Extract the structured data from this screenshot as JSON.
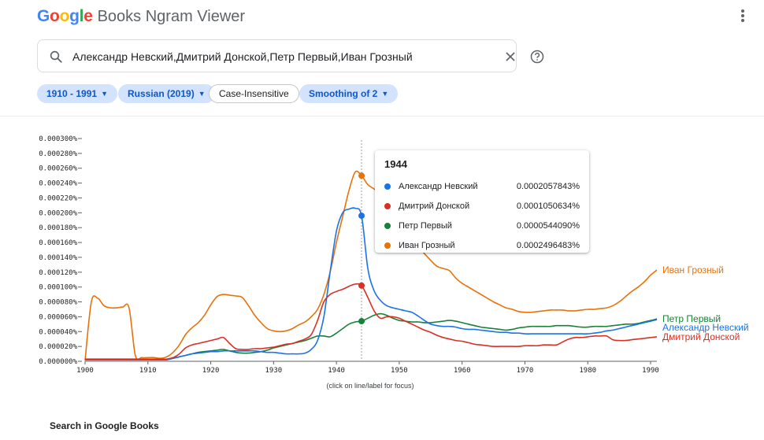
{
  "header": {
    "logo_text": "Google",
    "logo_letters": [
      {
        "ch": "G",
        "color": "#4285F4"
      },
      {
        "ch": "o",
        "color": "#EA4335"
      },
      {
        "ch": "o",
        "color": "#FBBC05"
      },
      {
        "ch": "g",
        "color": "#4285F4"
      },
      {
        "ch": "l",
        "color": "#34A853"
      },
      {
        "ch": "e",
        "color": "#EA4335"
      }
    ],
    "product_name": "Books Ngram Viewer"
  },
  "search": {
    "query": "Александр Невский,Дмитрий Донской,Петр Первый,Иван Грозный"
  },
  "filters": {
    "year_range": "1910 - 1991",
    "corpus": "Russian (2019)",
    "case": "Case-Insensitive",
    "smoothing": "Smoothing of 2"
  },
  "tooltip": {
    "year": "1944",
    "rows": [
      {
        "name": "Александр Невский",
        "value": "0.0002057843%",
        "color": "#1a73e8"
      },
      {
        "name": "Дмитрий Донской",
        "value": "0.0001050634%",
        "color": "#d93025"
      },
      {
        "name": "Петр Первый",
        "value": "0.0000544090%",
        "color": "#188038"
      },
      {
        "name": "Иван Грозный",
        "value": "0.0002496483%",
        "color": "#e8710a"
      }
    ]
  },
  "click_hint": "(click on line/label for focus)",
  "footer": {
    "books_link": "Search in Google Books"
  },
  "chart_data": {
    "type": "line",
    "title": "",
    "xlabel": "",
    "ylabel": "",
    "xlim": [
      1900,
      1991
    ],
    "ylim": [
      0,
      0.0003
    ],
    "x_ticks": [
      1900,
      1910,
      1920,
      1930,
      1940,
      1950,
      1960,
      1970,
      1980,
      1990
    ],
    "y_ticks": [
      {
        "v": 0,
        "label": "0.000000%"
      },
      {
        "v": 2e-05,
        "label": "0.000020%"
      },
      {
        "v": 4e-05,
        "label": "0.000040%"
      },
      {
        "v": 6e-05,
        "label": "0.000060%"
      },
      {
        "v": 8e-05,
        "label": "0.000080%"
      },
      {
        "v": 0.0001,
        "label": "0.000100%"
      },
      {
        "v": 0.00012,
        "label": "0.000120%"
      },
      {
        "v": 0.00014,
        "label": "0.000140%"
      },
      {
        "v": 0.00016,
        "label": "0.000160%"
      },
      {
        "v": 0.00018,
        "label": "0.000180%"
      },
      {
        "v": 0.0002,
        "label": "0.000200%"
      },
      {
        "v": 0.00022,
        "label": "0.000220%"
      },
      {
        "v": 0.00024,
        "label": "0.000240%"
      },
      {
        "v": 0.00026,
        "label": "0.000260%"
      },
      {
        "v": 0.00028,
        "label": "0.000280%"
      },
      {
        "v": 0.0003,
        "label": "0.000300%"
      }
    ],
    "highlight_year": 1944,
    "grid": false,
    "legend": "right-end labels",
    "x": [
      1900,
      1901,
      1902,
      1903,
      1904,
      1905,
      1906,
      1907,
      1908,
      1909,
      1910,
      1911,
      1912,
      1913,
      1914,
      1915,
      1916,
      1917,
      1918,
      1919,
      1920,
      1921,
      1922,
      1923,
      1924,
      1925,
      1926,
      1927,
      1928,
      1929,
      1930,
      1931,
      1932,
      1933,
      1934,
      1935,
      1936,
      1937,
      1938,
      1939,
      1940,
      1941,
      1942,
      1943,
      1944,
      1945,
      1946,
      1947,
      1948,
      1949,
      1950,
      1951,
      1952,
      1953,
      1954,
      1955,
      1956,
      1957,
      1958,
      1959,
      1960,
      1961,
      1962,
      1963,
      1964,
      1965,
      1966,
      1967,
      1968,
      1969,
      1970,
      1971,
      1972,
      1973,
      1974,
      1975,
      1976,
      1977,
      1978,
      1979,
      1980,
      1981,
      1982,
      1983,
      1984,
      1985,
      1986,
      1987,
      1988,
      1989,
      1990,
      1991
    ],
    "series": [
      {
        "name": "Иван Грозный",
        "color": "#e8710a",
        "values": [
          1e-06,
          8e-05,
          8.5e-05,
          7.5e-05,
          7.2e-05,
          7.2e-05,
          7.3e-05,
          7.2e-05,
          8e-06,
          5e-06,
          5e-06,
          5e-06,
          4e-06,
          6e-06,
          1.2e-05,
          2.2e-05,
          3.6e-05,
          4.5e-05,
          5.2e-05,
          6.2e-05,
          7.6e-05,
          8.7e-05,
          9e-05,
          8.9e-05,
          8.8e-05,
          8.6e-05,
          7.5e-05,
          6.2e-05,
          5.2e-05,
          4.4e-05,
          4.1e-05,
          4e-05,
          4.1e-05,
          4.4e-05,
          4.9e-05,
          5.3e-05,
          6e-05,
          7e-05,
          9e-05,
          0.00012,
          0.00016,
          0.000195,
          0.00023,
          0.000255,
          0.00025,
          0.000238,
          0.000232,
          0.000225,
          0.00021,
          0.000196,
          0.00018,
          0.00017,
          0.000165,
          0.000155,
          0.000145,
          0.000136,
          0.000128,
          0.000125,
          0.000122,
          0.000112,
          0.000105,
          0.0001,
          9.5e-05,
          9e-05,
          8.5e-05,
          8e-05,
          7.6e-05,
          7.2e-05,
          7e-05,
          6.7e-05,
          6.6e-05,
          6.6e-05,
          6.7e-05,
          6.8e-05,
          6.9e-05,
          6.9e-05,
          6.9e-05,
          6.8e-05,
          6.8e-05,
          6.9e-05,
          7e-05,
          7e-05,
          7.1e-05,
          7.2e-05,
          7.5e-05,
          8e-05,
          8.7e-05,
          9.4e-05,
          0.0001,
          0.000107,
          0.000116,
          0.000123
        ]
      },
      {
        "name": "Петр Первый",
        "color": "#188038",
        "values": [
          2e-06,
          2e-06,
          2e-06,
          2e-06,
          2e-06,
          2e-06,
          2e-06,
          2e-06,
          2e-06,
          2e-06,
          2e-06,
          2e-06,
          2e-06,
          2e-06,
          4e-06,
          6e-06,
          8e-06,
          1e-05,
          1.2e-05,
          1.3e-05,
          1.4e-05,
          1.5e-05,
          1.6e-05,
          1.4e-05,
          1.2e-05,
          1.1e-05,
          1.1e-05,
          1.2e-05,
          1.3e-05,
          1.5e-05,
          1.8e-05,
          2e-05,
          2.2e-05,
          2.4e-05,
          2.6e-05,
          2.8e-05,
          3.1e-05,
          3.4e-05,
          3.4e-05,
          3.3e-05,
          3.8e-05,
          4.4e-05,
          5e-05,
          5.3e-05,
          5.4e-05,
          5.8e-05,
          6.2e-05,
          6.4e-05,
          6.2e-05,
          5.8e-05,
          5.5e-05,
          5.4e-05,
          5.3e-05,
          5.3e-05,
          5.2e-05,
          5.2e-05,
          5.3e-05,
          5.4e-05,
          5.5e-05,
          5.4e-05,
          5.2e-05,
          5e-05,
          4.8e-05,
          4.6e-05,
          4.5e-05,
          4.4e-05,
          4.3e-05,
          4.2e-05,
          4.3e-05,
          4.5e-05,
          4.6e-05,
          4.7e-05,
          4.7e-05,
          4.7e-05,
          4.7e-05,
          4.8e-05,
          4.8e-05,
          4.8e-05,
          4.7e-05,
          4.6e-05,
          4.6e-05,
          4.7e-05,
          4.7e-05,
          4.7e-05,
          4.8e-05,
          4.9e-05,
          5e-05,
          5e-05,
          5.1e-05,
          5.3e-05,
          5.5e-05,
          5.7e-05
        ]
      },
      {
        "name": "Александр Невский",
        "color": "#1a73e8",
        "values": [
          2e-06,
          2e-06,
          2e-06,
          2e-06,
          2e-06,
          2e-06,
          2e-06,
          2e-06,
          2e-06,
          2e-06,
          2e-06,
          2e-06,
          2e-06,
          2e-06,
          4e-06,
          6e-06,
          8e-06,
          1e-05,
          1.1e-05,
          1.2e-05,
          1.3e-05,
          1.3e-05,
          1.4e-05,
          1.4e-05,
          1.4e-05,
          1.4e-05,
          1.4e-05,
          1.4e-05,
          1.3e-05,
          1.2e-05,
          1.2e-05,
          1.1e-05,
          1e-05,
          1e-05,
          1e-05,
          1.1e-05,
          1.6e-05,
          2.8e-05,
          6e-05,
          0.00012,
          0.000175,
          0.0002,
          0.000205,
          0.000206,
          0.000196,
          0.000125,
          9.5e-05,
          8.2e-05,
          7.5e-05,
          7.2e-05,
          7e-05,
          6.8e-05,
          6.6e-05,
          6.1e-05,
          5.5e-05,
          5e-05,
          4.8e-05,
          4.7e-05,
          4.7e-05,
          4.6e-05,
          4.4e-05,
          4.3e-05,
          4.3e-05,
          4.2e-05,
          4.1e-05,
          4e-05,
          3.9e-05,
          3.9e-05,
          3.8e-05,
          3.8e-05,
          3.7e-05,
          3.7e-05,
          3.7e-05,
          3.7e-05,
          3.7e-05,
          3.7e-05,
          3.7e-05,
          3.7e-05,
          3.7e-05,
          3.7e-05,
          3.7e-05,
          3.8e-05,
          3.9e-05,
          4.1e-05,
          4.2e-05,
          4.4e-05,
          4.6e-05,
          4.8e-05,
          5e-05,
          5.2e-05,
          5.4e-05,
          5.6e-05
        ]
      },
      {
        "name": "Дмитрий Донской",
        "color": "#d93025",
        "values": [
          3e-06,
          3e-06,
          3e-06,
          3e-06,
          3e-06,
          3e-06,
          3e-06,
          3e-06,
          3e-06,
          3e-06,
          3e-06,
          3e-06,
          3e-06,
          3e-06,
          5e-06,
          1e-05,
          1.8e-05,
          2.2e-05,
          2.4e-05,
          2.6e-05,
          2.8e-05,
          3e-05,
          3.2e-05,
          2.4e-05,
          1.7e-05,
          1.6e-05,
          1.6e-05,
          1.7e-05,
          1.7e-05,
          1.8e-05,
          1.9e-05,
          2.1e-05,
          2.3e-05,
          2.4e-05,
          2.7e-05,
          3e-05,
          3.6e-05,
          5.5e-05,
          8e-05,
          9e-05,
          9.4e-05,
          9.7e-05,
          0.000101,
          0.000104,
          0.000102,
          8.6e-05,
          6.8e-05,
          5.8e-05,
          6e-05,
          6e-05,
          5.8e-05,
          5.4e-05,
          5e-05,
          4.6e-05,
          4.2e-05,
          3.9e-05,
          3.5e-05,
          3.2e-05,
          3e-05,
          2.8e-05,
          2.7e-05,
          2.5e-05,
          2.3e-05,
          2.2e-05,
          2.1e-05,
          2e-05,
          2e-05,
          2e-05,
          2e-05,
          2e-05,
          2.1e-05,
          2.1e-05,
          2.1e-05,
          2.2e-05,
          2.2e-05,
          2.2e-05,
          2.6e-05,
          3e-05,
          3.2e-05,
          3.2e-05,
          3.3e-05,
          3.4e-05,
          3.4e-05,
          3.4e-05,
          2.9e-05,
          2.8e-05,
          2.8e-05,
          2.9e-05,
          3e-05,
          3.1e-05,
          3.2e-05,
          3.3e-05
        ]
      }
    ]
  }
}
